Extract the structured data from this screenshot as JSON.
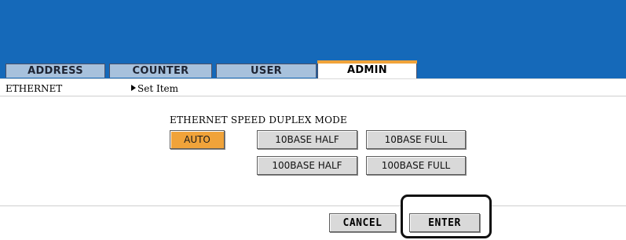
{
  "tabs": [
    {
      "label": "ADDRESS",
      "active": false
    },
    {
      "label": "COUNTER",
      "active": false
    },
    {
      "label": "USER",
      "active": false
    },
    {
      "label": "ADMIN",
      "active": true
    }
  ],
  "breadcrumb": {
    "section": "ETHERNET",
    "item": "Set Item"
  },
  "setting": {
    "group_label": "ETHERNET SPEED DUPLEX MODE",
    "options": [
      {
        "label": "AUTO",
        "selected": true
      },
      {
        "label": "10BASE HALF",
        "selected": false
      },
      {
        "label": "10BASE FULL",
        "selected": false
      },
      {
        "label": "100BASE HALF",
        "selected": false
      },
      {
        "label": "100BASE FULL",
        "selected": false
      }
    ]
  },
  "actions": {
    "cancel_label": "CANCEL",
    "enter_label": "ENTER"
  },
  "colors": {
    "header_blue": "#1569b9",
    "tab_inactive": "#a7c1dc",
    "selected_orange": "#f0a33a",
    "button_gray": "#d9d9d9"
  }
}
